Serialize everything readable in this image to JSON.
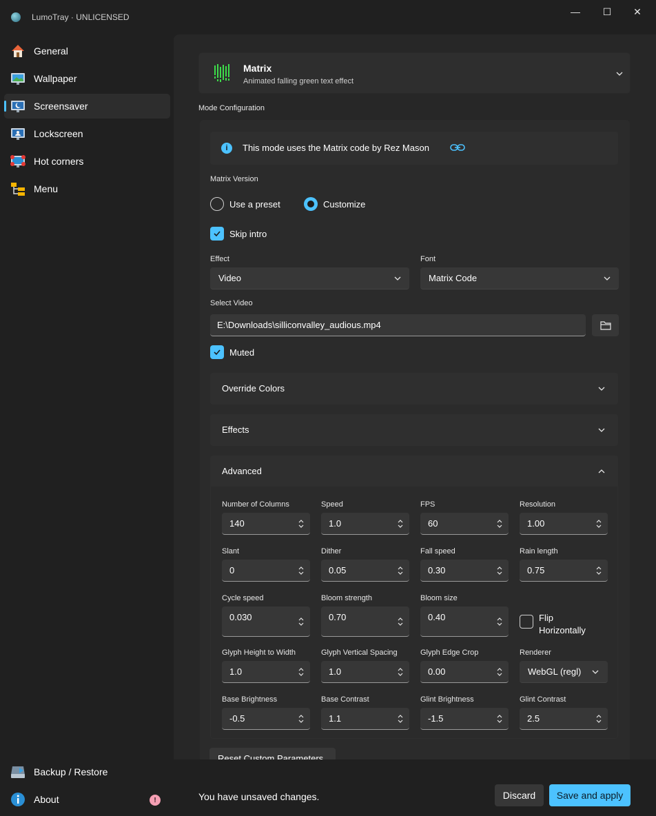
{
  "app": {
    "title": "LumoTray · UNLICENSED"
  },
  "window_controls": {
    "minimize": "—",
    "maximize": "☐",
    "close": "✕"
  },
  "sidebar": {
    "items": [
      {
        "label": "General",
        "icon": "home-icon"
      },
      {
        "label": "Wallpaper",
        "icon": "wallpaper-icon"
      },
      {
        "label": "Screensaver",
        "icon": "screensaver-icon",
        "active": true
      },
      {
        "label": "Lockscreen",
        "icon": "lockscreen-icon"
      },
      {
        "label": "Hot corners",
        "icon": "hot-corners-icon"
      },
      {
        "label": "Menu",
        "icon": "menu-icon"
      }
    ],
    "bottom_items": [
      {
        "label": "Backup / Restore",
        "icon": "backup-icon"
      },
      {
        "label": "About",
        "icon": "info-icon",
        "badge": "!"
      }
    ]
  },
  "mode": {
    "title": "Matrix",
    "description": "Animated falling green text effect"
  },
  "config": {
    "section_label": "Mode Configuration",
    "info": "This mode uses the Matrix code by Rez Mason",
    "matrix_version_label": "Matrix Version",
    "version_options": [
      {
        "label": "Use a preset",
        "selected": false
      },
      {
        "label": "Customize",
        "selected": true
      }
    ],
    "skip_intro": {
      "label": "Skip intro",
      "checked": true
    },
    "effect": {
      "label": "Effect",
      "value": "Video"
    },
    "font": {
      "label": "Font",
      "value": "Matrix Code"
    },
    "select_video": {
      "label": "Select Video",
      "value": "E:\\Downloads\\silliconvalley_audious.mp4"
    },
    "muted": {
      "label": "Muted",
      "checked": true
    },
    "expanders": {
      "override_colors": "Override Colors",
      "effects": "Effects",
      "advanced": "Advanced"
    },
    "advanced": {
      "number_of_columns": {
        "label": "Number of Columns",
        "value": "140"
      },
      "speed": {
        "label": "Speed",
        "value": "1.0"
      },
      "fps": {
        "label": "FPS",
        "value": "60"
      },
      "resolution": {
        "label": "Resolution",
        "value": "1.00"
      },
      "slant": {
        "label": "Slant",
        "value": "0"
      },
      "dither": {
        "label": "Dither",
        "value": "0.05"
      },
      "fall_speed": {
        "label": "Fall speed",
        "value": "0.30"
      },
      "rain_length": {
        "label": "Rain length",
        "value": "0.75"
      },
      "cycle_speed": {
        "label": "Cycle speed",
        "value": "0.030"
      },
      "bloom_strength": {
        "label": "Bloom strength",
        "value": "0.70"
      },
      "bloom_size": {
        "label": "Bloom size",
        "value": "0.40"
      },
      "flip_horizontally": {
        "line1": "Flip",
        "line2": "Horizontally",
        "checked": false
      },
      "glyph_height_to_width": {
        "label": "Glyph Height to Width",
        "value": "1.0"
      },
      "glyph_vertical_spacing": {
        "label": "Glyph Vertical Spacing",
        "value": "1.0"
      },
      "glyph_edge_crop": {
        "label": "Glyph Edge Crop",
        "value": "0.00"
      },
      "renderer": {
        "label": "Renderer",
        "value": "WebGL (regl)"
      },
      "base_brightness": {
        "label": "Base Brightness",
        "value": "-0.5"
      },
      "base_contrast": {
        "label": "Base Contrast",
        "value": "1.1"
      },
      "glint_brightness": {
        "label": "Glint Brightness",
        "value": "-1.5"
      },
      "glint_contrast": {
        "label": "Glint Contrast",
        "value": "2.5"
      }
    },
    "reset_button": "Reset Custom Parameters"
  },
  "footer": {
    "unsaved": "You have unsaved changes.",
    "discard": "Discard",
    "save": "Save and apply"
  },
  "colors": {
    "accent": "#4cc2ff",
    "background": "#202020",
    "panel": "#2b2b2b"
  }
}
